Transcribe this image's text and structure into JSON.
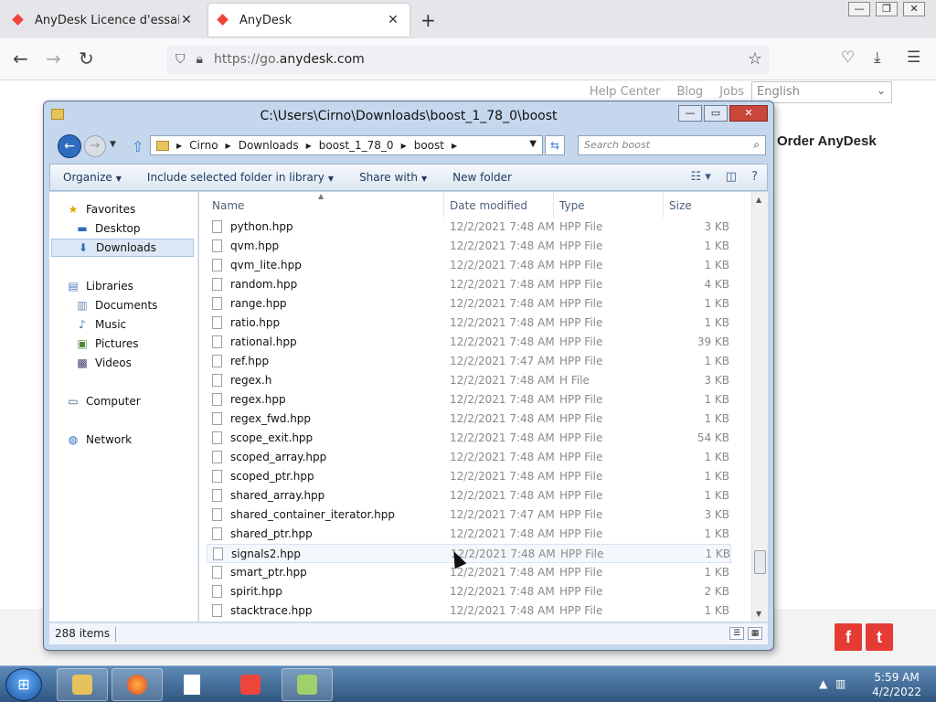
{
  "browser": {
    "tabs": [
      {
        "label": "AnyDesk Licence d'essai",
        "active": false
      },
      {
        "label": "AnyDesk",
        "active": true
      }
    ],
    "new_tab_label": "+",
    "url_prefix": "https://go.",
    "url_host": "anydesk.com"
  },
  "webpage": {
    "top_links": [
      "Help Center",
      "Blog",
      "Jobs"
    ],
    "language": "English",
    "order_heading": "Order AnyDesk",
    "social": [
      "f",
      "t"
    ]
  },
  "explorer": {
    "title": "C:\\Users\\Cirno\\Downloads\\boost_1_78_0\\boost",
    "breadcrumbs": [
      "Cirno",
      "Downloads",
      "boost_1_78_0",
      "boost"
    ],
    "search_placeholder": "Search boost",
    "toolbar": {
      "organize": "Organize",
      "include": "Include selected folder in library",
      "share": "Share with",
      "new_folder": "New folder"
    },
    "nav": {
      "favorites": "Favorites",
      "desktop": "Desktop",
      "downloads": "Downloads",
      "libraries": "Libraries",
      "documents": "Documents",
      "music": "Music",
      "pictures": "Pictures",
      "videos": "Videos",
      "computer": "Computer",
      "network": "Network"
    },
    "columns": {
      "name": "Name",
      "date": "Date modified",
      "type": "Type",
      "size": "Size"
    },
    "files": [
      {
        "name": "python.hpp",
        "date": "12/2/2021 7:48 AM",
        "type": "HPP File",
        "size": "3 KB"
      },
      {
        "name": "qvm.hpp",
        "date": "12/2/2021 7:48 AM",
        "type": "HPP File",
        "size": "1 KB"
      },
      {
        "name": "qvm_lite.hpp",
        "date": "12/2/2021 7:48 AM",
        "type": "HPP File",
        "size": "1 KB"
      },
      {
        "name": "random.hpp",
        "date": "12/2/2021 7:48 AM",
        "type": "HPP File",
        "size": "4 KB"
      },
      {
        "name": "range.hpp",
        "date": "12/2/2021 7:48 AM",
        "type": "HPP File",
        "size": "1 KB"
      },
      {
        "name": "ratio.hpp",
        "date": "12/2/2021 7:48 AM",
        "type": "HPP File",
        "size": "1 KB"
      },
      {
        "name": "rational.hpp",
        "date": "12/2/2021 7:48 AM",
        "type": "HPP File",
        "size": "39 KB"
      },
      {
        "name": "ref.hpp",
        "date": "12/2/2021 7:47 AM",
        "type": "HPP File",
        "size": "1 KB"
      },
      {
        "name": "regex.h",
        "date": "12/2/2021 7:48 AM",
        "type": "H File",
        "size": "3 KB"
      },
      {
        "name": "regex.hpp",
        "date": "12/2/2021 7:48 AM",
        "type": "HPP File",
        "size": "1 KB"
      },
      {
        "name": "regex_fwd.hpp",
        "date": "12/2/2021 7:48 AM",
        "type": "HPP File",
        "size": "1 KB"
      },
      {
        "name": "scope_exit.hpp",
        "date": "12/2/2021 7:48 AM",
        "type": "HPP File",
        "size": "54 KB"
      },
      {
        "name": "scoped_array.hpp",
        "date": "12/2/2021 7:48 AM",
        "type": "HPP File",
        "size": "1 KB"
      },
      {
        "name": "scoped_ptr.hpp",
        "date": "12/2/2021 7:48 AM",
        "type": "HPP File",
        "size": "1 KB"
      },
      {
        "name": "shared_array.hpp",
        "date": "12/2/2021 7:48 AM",
        "type": "HPP File",
        "size": "1 KB"
      },
      {
        "name": "shared_container_iterator.hpp",
        "date": "12/2/2021 7:47 AM",
        "type": "HPP File",
        "size": "3 KB"
      },
      {
        "name": "shared_ptr.hpp",
        "date": "12/2/2021 7:48 AM",
        "type": "HPP File",
        "size": "1 KB"
      },
      {
        "name": "signals2.hpp",
        "date": "12/2/2021 7:48 AM",
        "type": "HPP File",
        "size": "1 KB"
      },
      {
        "name": "smart_ptr.hpp",
        "date": "12/2/2021 7:48 AM",
        "type": "HPP File",
        "size": "1 KB"
      },
      {
        "name": "spirit.hpp",
        "date": "12/2/2021 7:48 AM",
        "type": "HPP File",
        "size": "2 KB"
      },
      {
        "name": "stacktrace.hpp",
        "date": "12/2/2021 7:48 AM",
        "type": "HPP File",
        "size": "1 KB"
      }
    ],
    "item_count": "288 items"
  },
  "taskbar": {
    "time": "5:59 AM",
    "date": "4/2/2022"
  },
  "colors": {
    "anydesk_red": "#ef443b",
    "window_frame": "#c5d7ec",
    "taskbar": "#2f5680"
  }
}
